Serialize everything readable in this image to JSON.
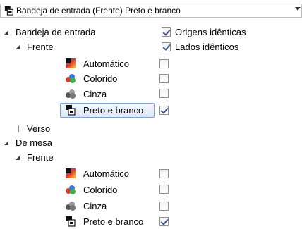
{
  "combo": {
    "selected": "Bandeja de entrada (Frente) Preto e branco",
    "icon": "bw-mode-icon"
  },
  "options": {
    "identical_sources": {
      "label": "Origens idênticas",
      "checked": true
    },
    "identical_sides": {
      "label": "Lados idênticos",
      "checked": true
    }
  },
  "tree": {
    "input_tray": {
      "label": "Bandeja de entrada",
      "front": {
        "label": "Frente",
        "modes": [
          {
            "label": "Automático",
            "icon": "auto-mode-icon",
            "checked": false
          },
          {
            "label": "Colorido",
            "icon": "color-mode-icon",
            "checked": false
          },
          {
            "label": "Cinza",
            "icon": "gray-mode-icon",
            "checked": false
          },
          {
            "label": "Preto e branco",
            "icon": "bw-mode-icon",
            "checked": true,
            "selected": true
          }
        ]
      },
      "back": {
        "label": "Verso"
      }
    },
    "flatbed": {
      "label": "De mesa",
      "front": {
        "label": "Frente",
        "modes": [
          {
            "label": "Automático",
            "icon": "auto-mode-icon",
            "checked": false
          },
          {
            "label": "Colorido",
            "icon": "color-mode-icon",
            "checked": false
          },
          {
            "label": "Cinza",
            "icon": "gray-mode-icon",
            "checked": false
          },
          {
            "label": "Preto e branco",
            "icon": "bw-mode-icon",
            "checked": true
          }
        ]
      }
    }
  }
}
